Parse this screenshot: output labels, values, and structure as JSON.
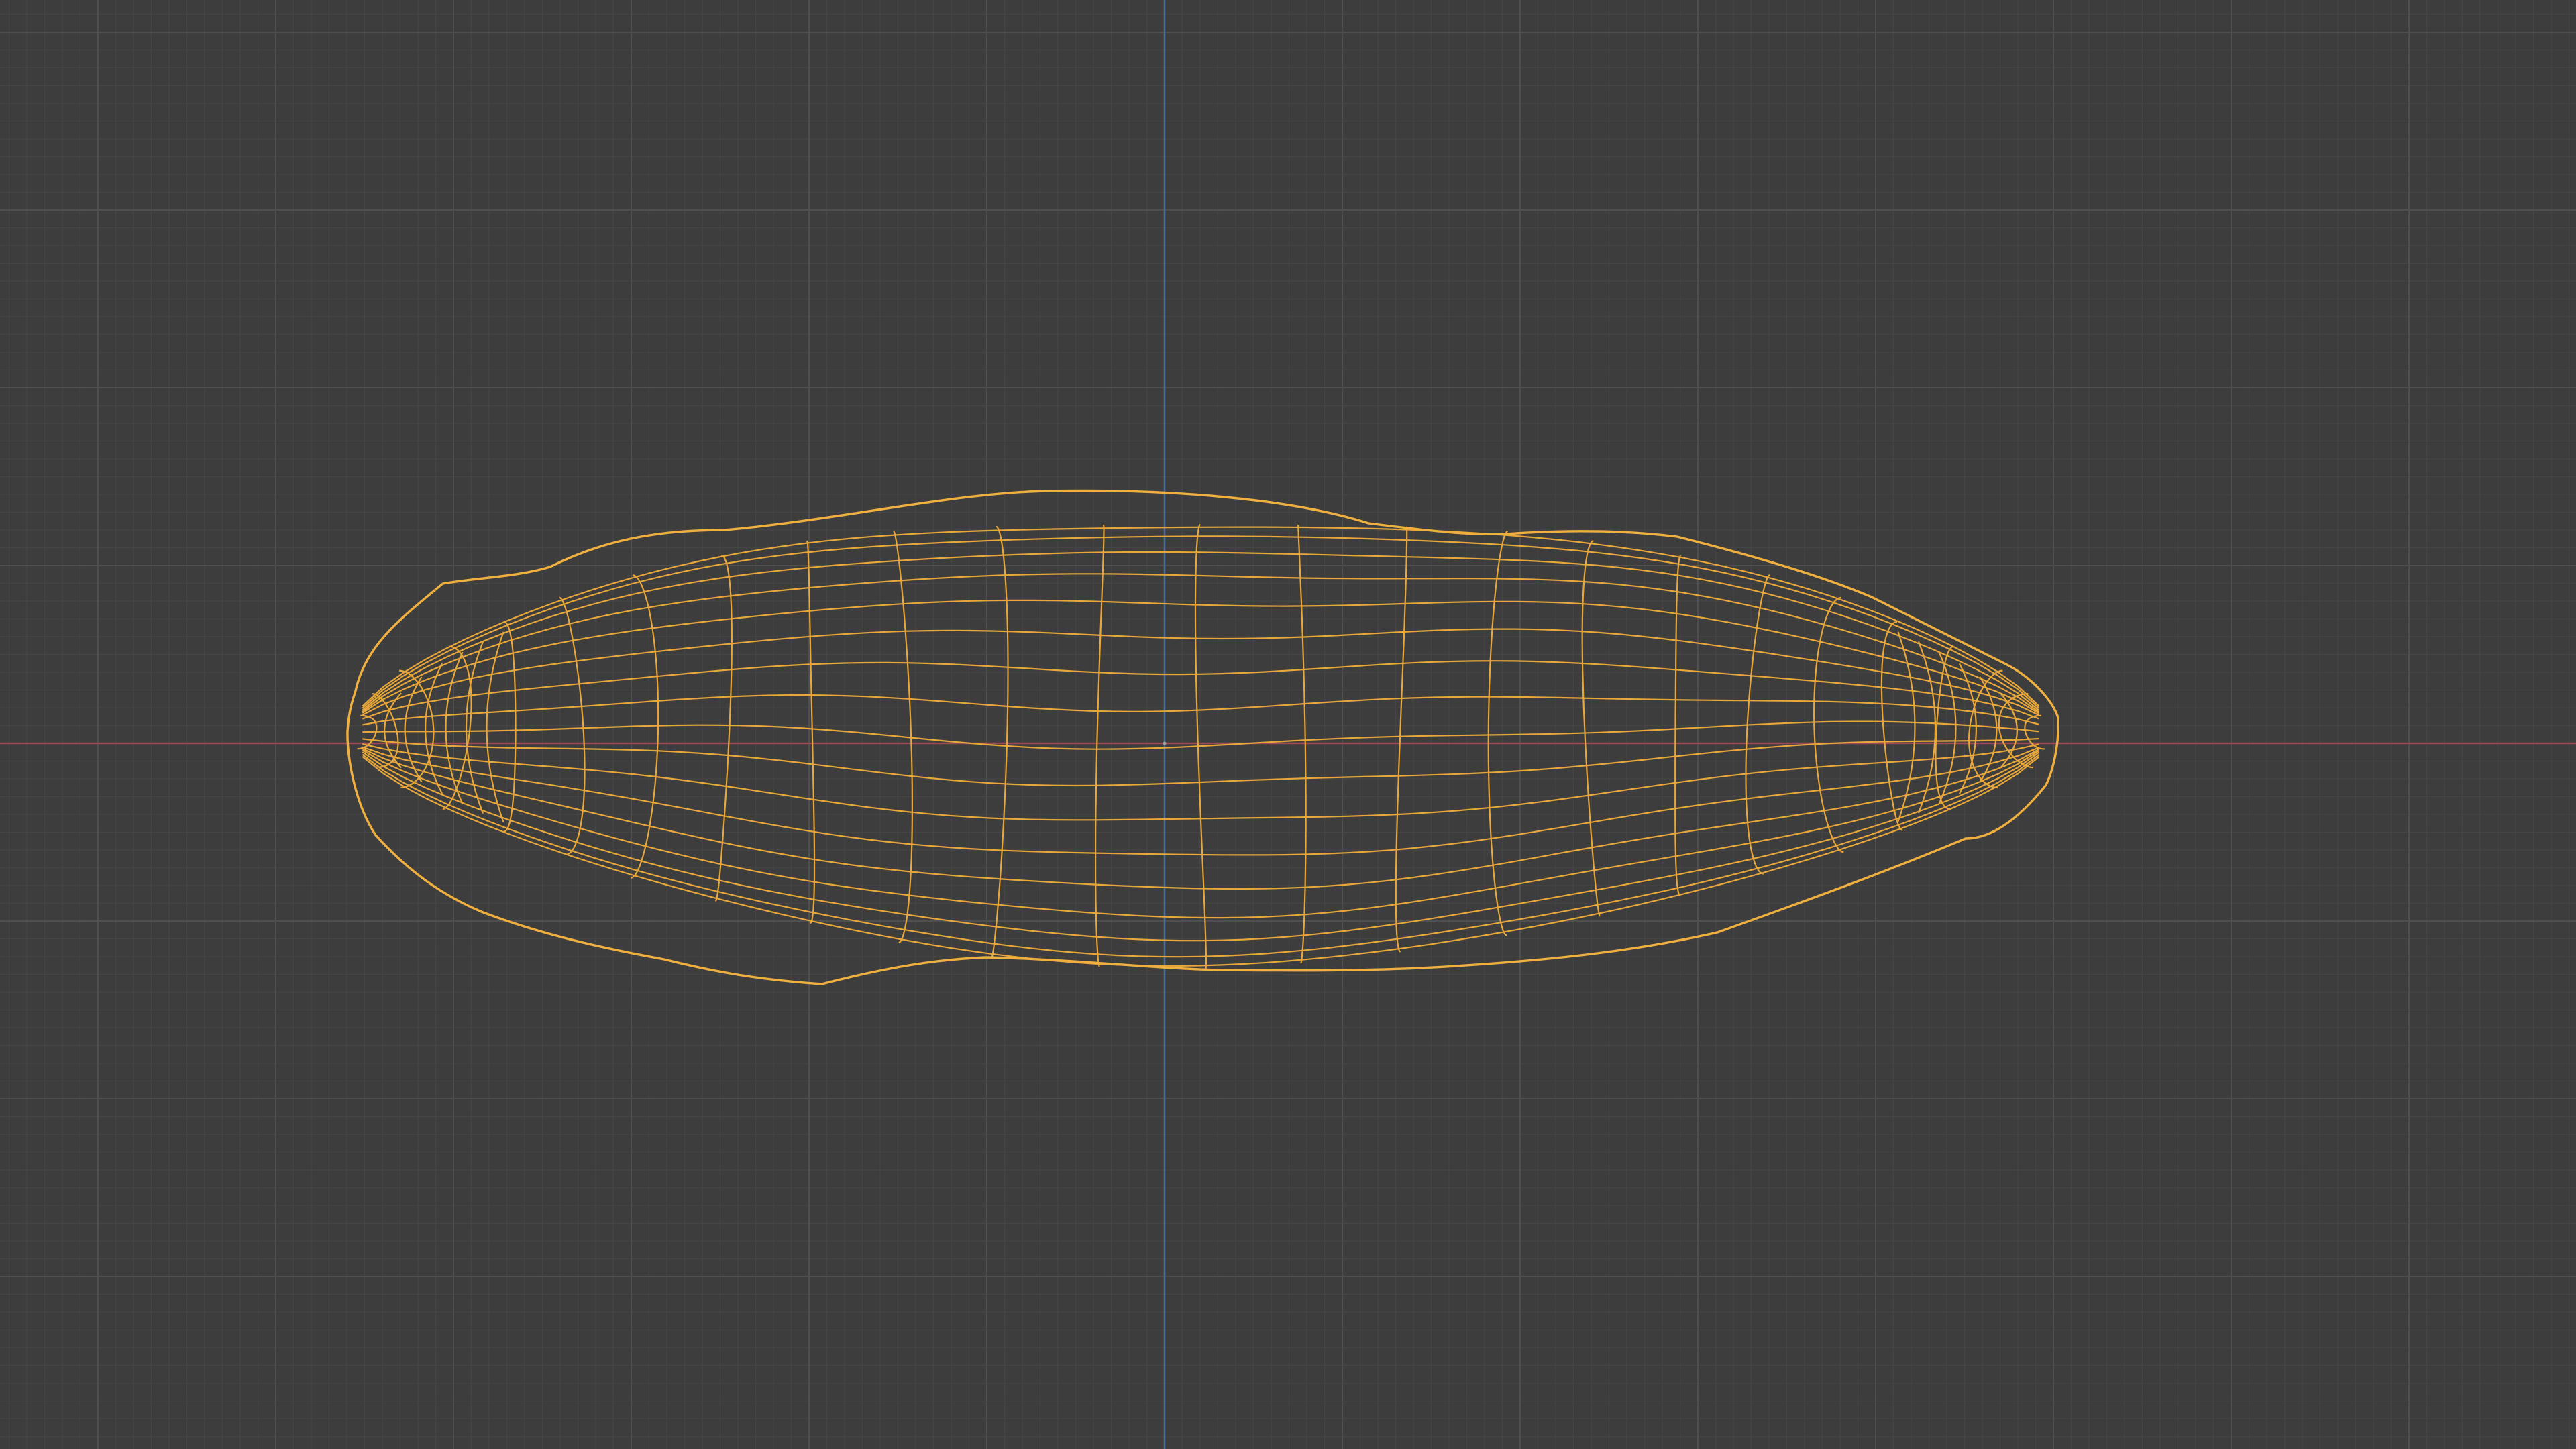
{
  "viewport": {
    "view": "orthographic-front",
    "mode": "wireframe",
    "selected": true,
    "grid_visible": true
  },
  "colors": {
    "background": "#3d3d3d",
    "grid_minor": "#454545",
    "grid_major": "#4f4f4f",
    "axis_x": "#9c4a55",
    "axis_z": "#4a6e9c",
    "wireframe": "#e8a73a",
    "wireframe_outline": "#f0b040",
    "origin_dot": "#a0a0a0"
  },
  "icons": {
    "origin": "object-origin-icon"
  }
}
